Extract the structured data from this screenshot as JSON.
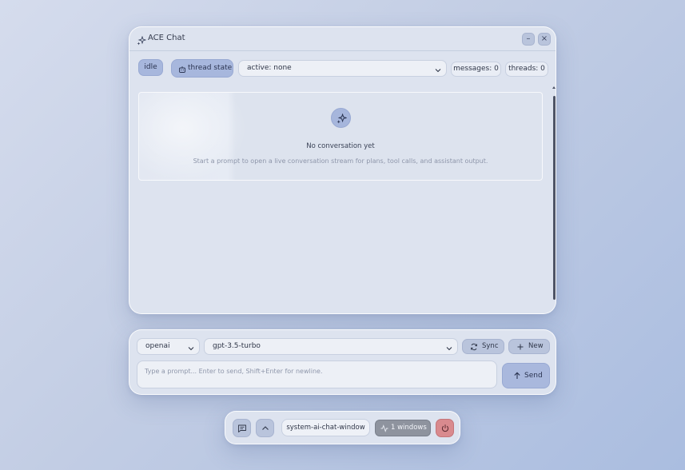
{
  "window": {
    "title": "ACE Chat",
    "title_icon": "sparkles-icon",
    "minimize_icon": "minimize-icon",
    "close_icon": "close-icon"
  },
  "toolbar": {
    "status": "idle",
    "thread_state_label": "thread state",
    "thread_state_icon": "bot-icon",
    "active_select_value": "active: none",
    "messages_label": "messages: 0",
    "threads_label": "threads: 0"
  },
  "empty_state": {
    "icon": "sparkles-icon",
    "title": "No conversation yet",
    "description": "Start a prompt to open a live conversation stream for plans, tool calls, and assistant output."
  },
  "composer": {
    "provider": "openai",
    "model": "gpt-3.5-turbo",
    "sync_label": "Sync",
    "new_label": "New",
    "prompt_placeholder": "Type a prompt... Enter to send, Shift+Enter for newline.",
    "send_label": "Send"
  },
  "taskbar": {
    "window_name": "system-ai-chat-window",
    "windows_count": "1 windows"
  },
  "colors": {
    "accent": "#a7b7dd",
    "power": "#d98a8e",
    "panel": "#dde3ef"
  }
}
